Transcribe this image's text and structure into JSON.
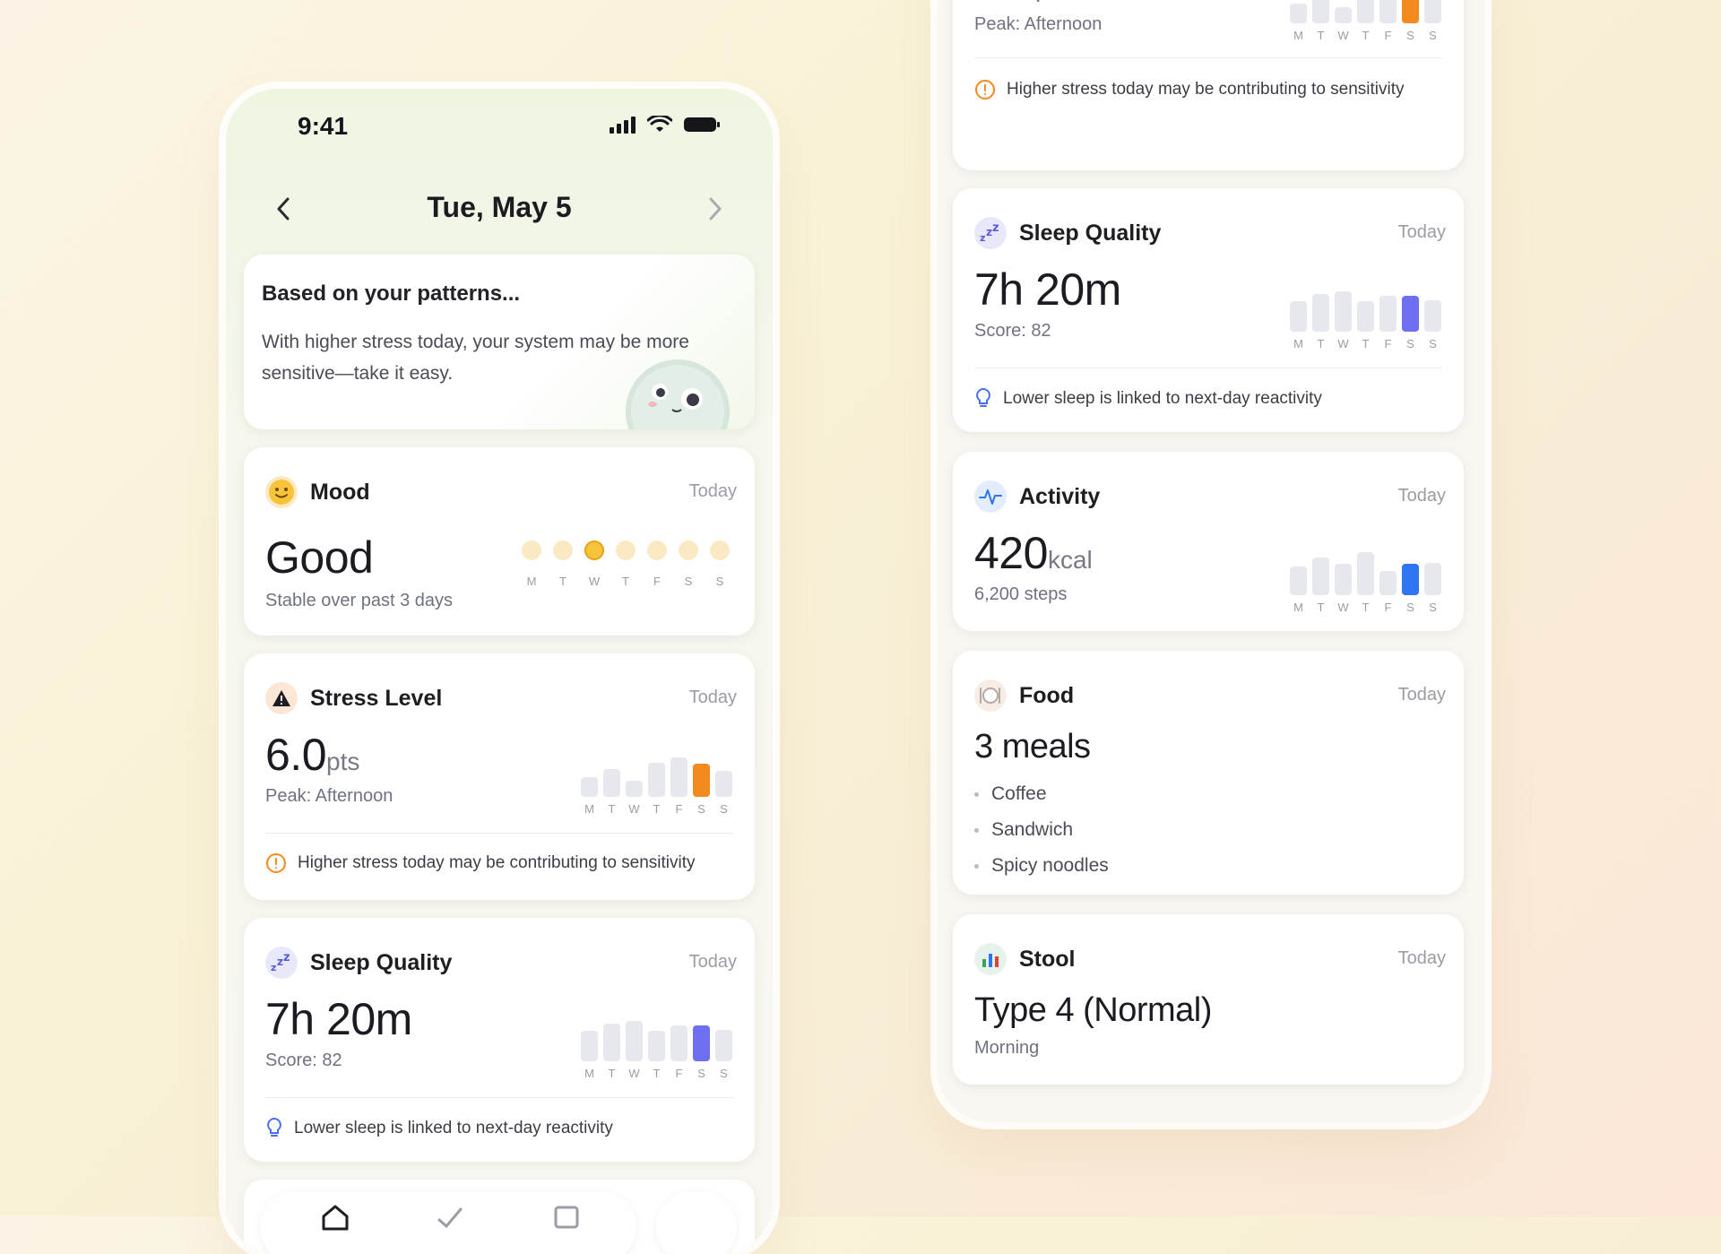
{
  "status": {
    "time": "9:41"
  },
  "header": {
    "date": "Tue, May 5"
  },
  "insight": {
    "title": "Based on your patterns...",
    "body": "With higher stress today, your system may be more sensitive—take it easy."
  },
  "days": [
    "M",
    "T",
    "W",
    "T",
    "F",
    "S",
    "S"
  ],
  "mood": {
    "title": "Mood",
    "when": "Today",
    "value": "Good",
    "sub": "Stable over past 3 days",
    "selected_index": 2
  },
  "stress": {
    "title": "Stress Level",
    "when": "Today",
    "value": "6.0",
    "unit": "pts",
    "sub": "Peak: Afternoon",
    "note": "Higher stress today may be contributing to sensitivity",
    "highlight_color": "#f28a1e",
    "bar_levels": [
      0.4,
      0.55,
      0.32,
      0.68,
      0.78,
      0.66,
      0.52
    ],
    "highlight_index": 5
  },
  "sleep": {
    "title": "Sleep Quality",
    "when": "Today",
    "value": "7h 20m",
    "sub": "Score: 82",
    "note": "Lower sleep is linked to next-day reactivity",
    "highlight_color": "#6e6ef0",
    "bar_levels": [
      0.6,
      0.75,
      0.8,
      0.6,
      0.72,
      0.72,
      0.62
    ],
    "highlight_index": 5
  },
  "activity": {
    "title": "Activity",
    "when": "Today",
    "value": "420",
    "unit": "kcal",
    "sub": "6,200 steps",
    "highlight_color": "#2f74f0",
    "bar_levels": [
      0.58,
      0.75,
      0.62,
      0.86,
      0.48,
      0.62,
      0.65
    ],
    "highlight_index": 5
  },
  "food": {
    "title": "Food",
    "when": "Today",
    "value": "3 meals",
    "items": [
      "Coffee",
      "Sandwich",
      "Spicy noodles"
    ]
  },
  "stool": {
    "title": "Stool",
    "when": "Today",
    "value": "Type 4 (Normal)",
    "sub": "Morning"
  }
}
